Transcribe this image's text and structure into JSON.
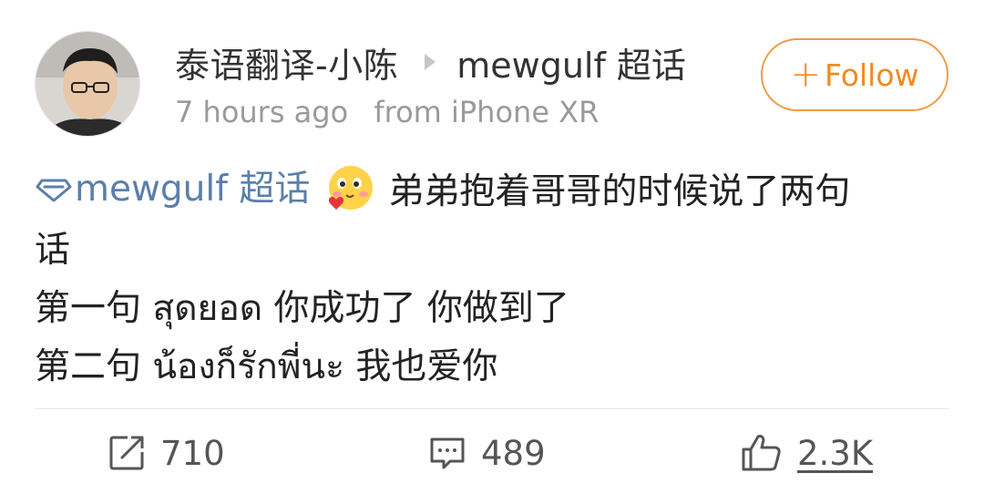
{
  "post": {
    "author": "泰语翻译-小陈",
    "topic": "mewgulf 超话",
    "time": "7 hours ago",
    "source": "from iPhone XR",
    "follow_label": "Follow",
    "follow_plus": "+",
    "super_topic_link": "mewgulf 超话",
    "text_line1": "弟弟抱着哥哥的时候说了两句",
    "text_line2": "话",
    "text_line3": "第一句 สุดยอด 你成功了 你做到了",
    "text_line4": "第二句 น้องก็รักพี่นะ 我也爱你"
  },
  "actions": {
    "repost_count": "710",
    "comment_count": "489",
    "like_count": "2.3K"
  },
  "icons": {
    "arrow": "triangle-right-icon",
    "follow": "plus-icon",
    "super_topic": "diamond-icon",
    "emoji": "blushing-face-icon",
    "repost": "share-square-icon",
    "comment": "comment-bubble-icon",
    "like": "thumbs-up-icon"
  },
  "colors": {
    "accent_orange": "#f08a1f",
    "link_blue": "#5b7faa",
    "meta_gray": "#9a9a9a"
  }
}
